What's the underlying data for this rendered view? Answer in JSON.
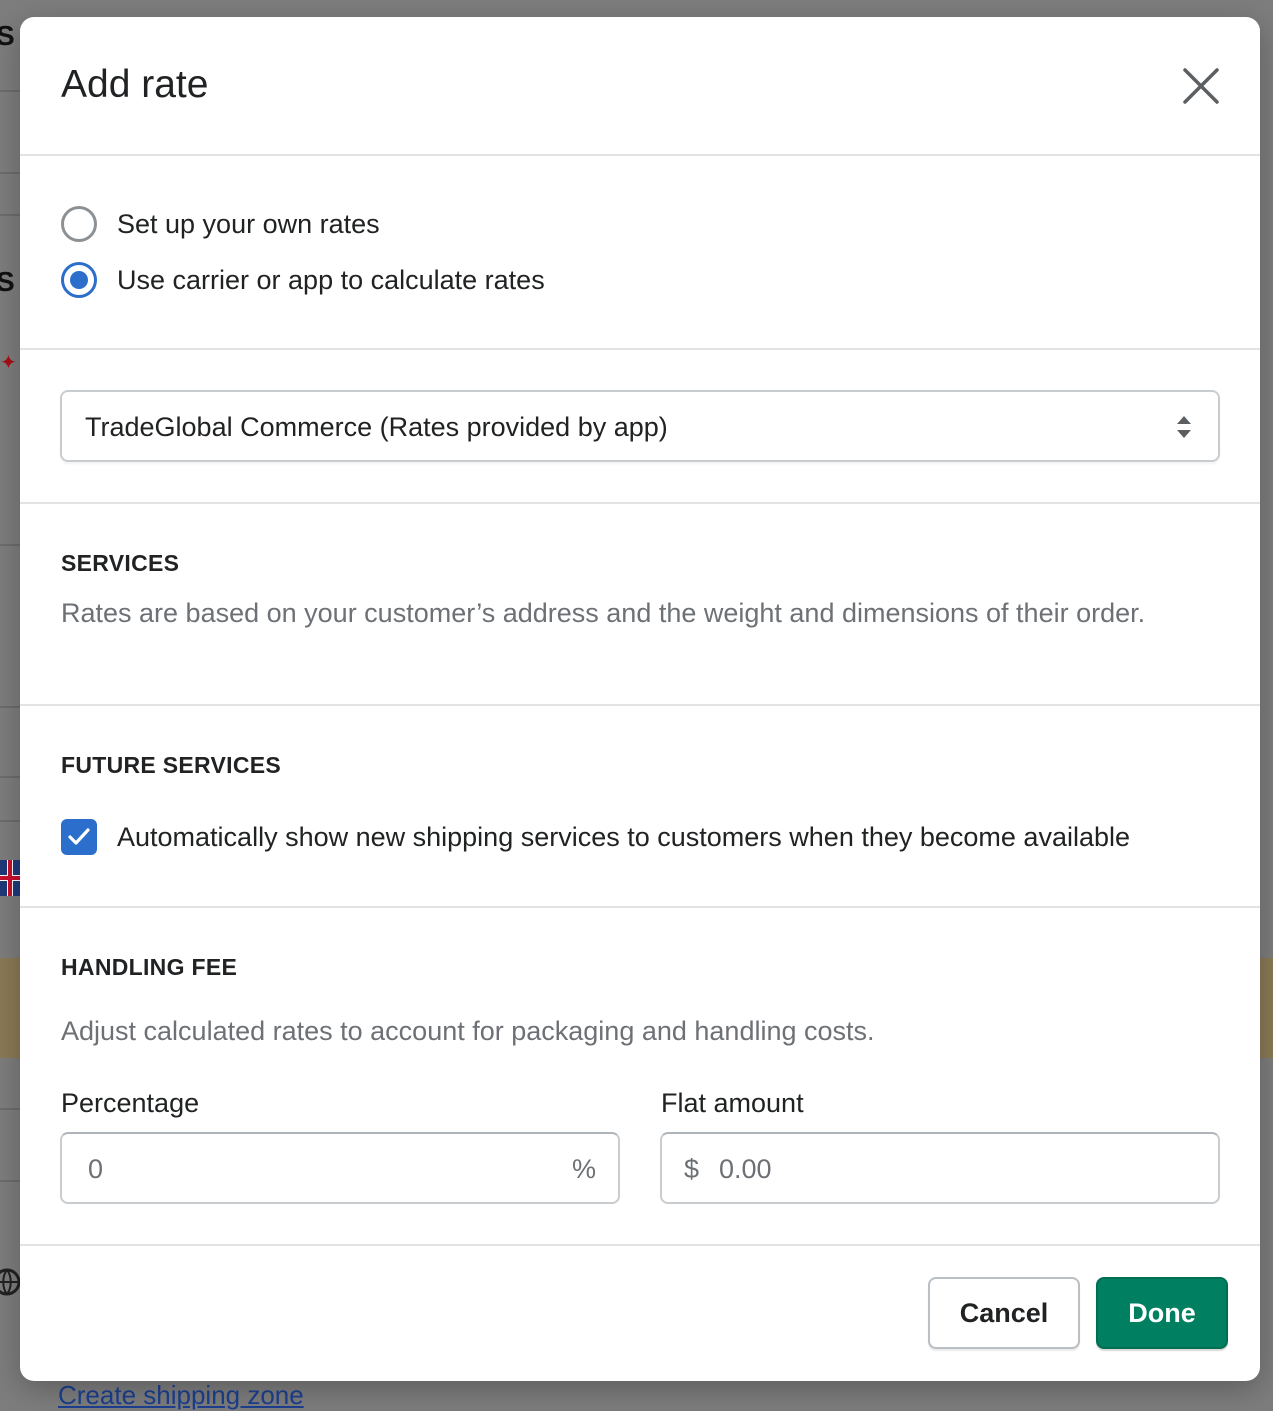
{
  "background": {
    "bottom_link": "Create shipping zone"
  },
  "modal": {
    "title": "Add rate",
    "rate_options": [
      {
        "label": "Set up your own rates",
        "selected": false
      },
      {
        "label": "Use carrier or app to calculate rates",
        "selected": true
      }
    ],
    "carrier_select": {
      "value": "TradeGlobal Commerce (Rates provided by app)"
    },
    "services": {
      "heading": "SERVICES",
      "description": "Rates are based on your customer’s address and the weight and dimensions of their order."
    },
    "future_services": {
      "heading": "FUTURE SERVICES",
      "checkbox_label": "Automatically show new shipping services to customers when they become available",
      "checked": true
    },
    "handling_fee": {
      "heading": "HANDLING FEE",
      "description": "Adjust calculated rates to account for packaging and handling costs.",
      "percentage_label": "Percentage",
      "percentage_placeholder": "0",
      "percentage_suffix": "%",
      "flat_label": "Flat amount",
      "flat_prefix": "$",
      "flat_placeholder": "0.00"
    },
    "footer": {
      "cancel_label": "Cancel",
      "done_label": "Done"
    }
  },
  "colors": {
    "accent_blue": "#2c6ecb",
    "primary_green": "#008060",
    "overlay": "#7d7d7d"
  }
}
